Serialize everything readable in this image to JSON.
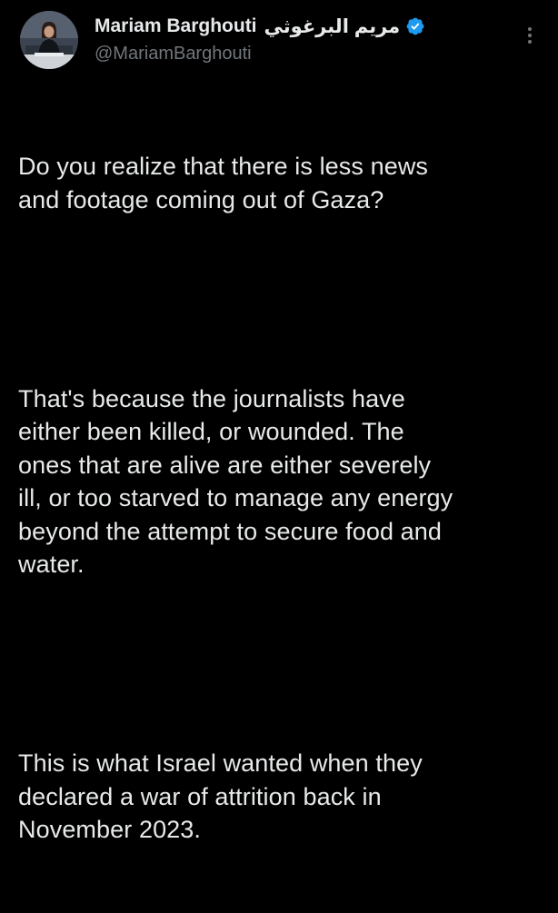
{
  "author": {
    "display_name": "Mariam Barghouti",
    "display_name_arabic": "مريم البرغوثي",
    "handle": "@MariamBarghouti",
    "avatar_icon": "profile-photo",
    "verified_icon": "verified-badge-icon",
    "verified_color": "#1d9bf0"
  },
  "menu": {
    "icon": "more-options-icon"
  },
  "tweet": {
    "paragraphs": [
      "Do you realize that there is less news\nand footage coming out of Gaza?",
      "That's because the journalists have\neither been killed, or wounded. The\nones that are alive are either severely\nill, or too starved to manage any energy\nbeyond the attempt to secure food and\nwater.",
      "This is what Israel wanted when they\ndeclared a war of attrition back in\nNovember 2023."
    ]
  },
  "colors": {
    "background": "#000000",
    "text_primary": "#e7e9ea",
    "text_secondary": "#71767b"
  }
}
